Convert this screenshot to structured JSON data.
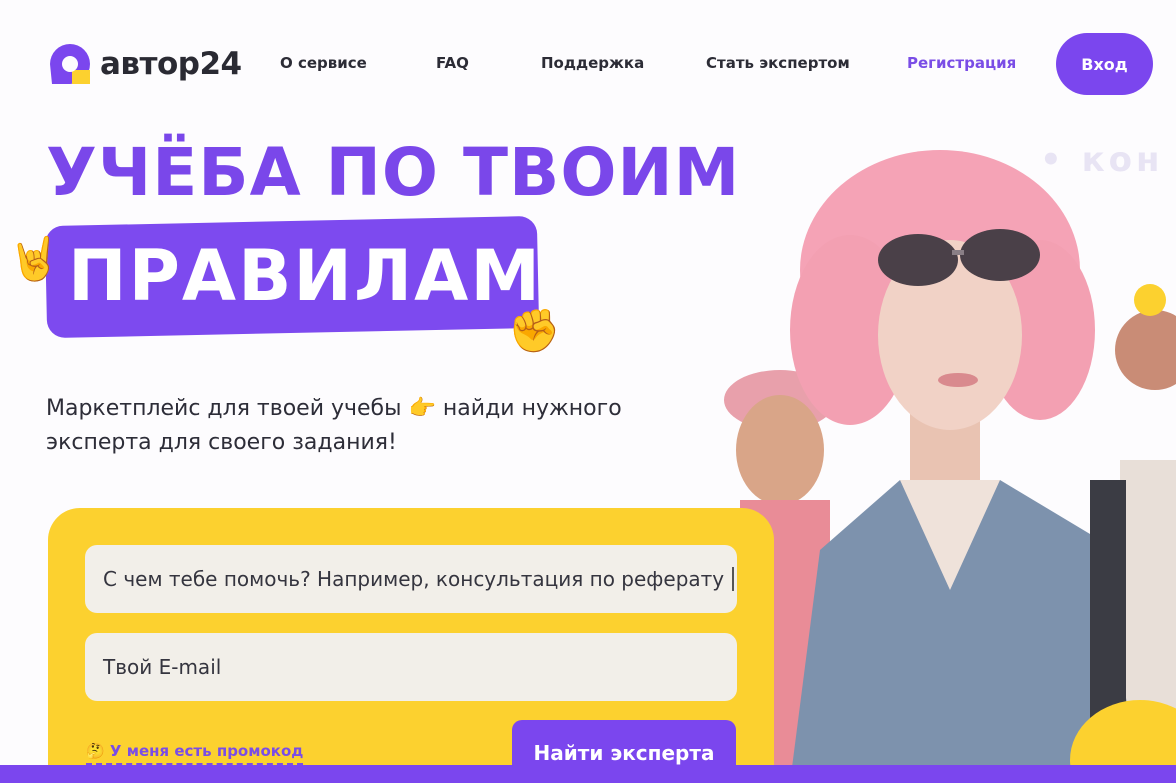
{
  "header": {
    "logo_text": "автор24",
    "nav": [
      {
        "label": "О сервисе"
      },
      {
        "label": "FAQ"
      },
      {
        "label": "Поддержка"
      },
      {
        "label": "Стать экспертом"
      }
    ],
    "register_label": "Регистрация",
    "login_label": "Вход"
  },
  "hero": {
    "line1": "УЧЁБА ПО ТВОИМ",
    "line2": "ПРАВИЛАМ",
    "subtitle_part1": "Маркетплейс для твоей учебы",
    "subtitle_part2": "найди нужного эксперта для своего задания!"
  },
  "form": {
    "task_value": "С чем тебе помочь? Например, консультация по реферату",
    "email_placeholder": "Твой E-mail",
    "promo_label": "У меня есть промокод",
    "submit_label": "Найти эксперта"
  },
  "background": {
    "watermark": "• кон"
  },
  "icons": {
    "rock_hand": "rock-hand-emoji",
    "fist": "fist-emoji",
    "pointing_hand": "pointing-hand-emoji"
  },
  "colors": {
    "brand_purple": "#7b46ee",
    "accent_yellow": "#fcd12f",
    "hair_pink": "#f5a3b6"
  }
}
